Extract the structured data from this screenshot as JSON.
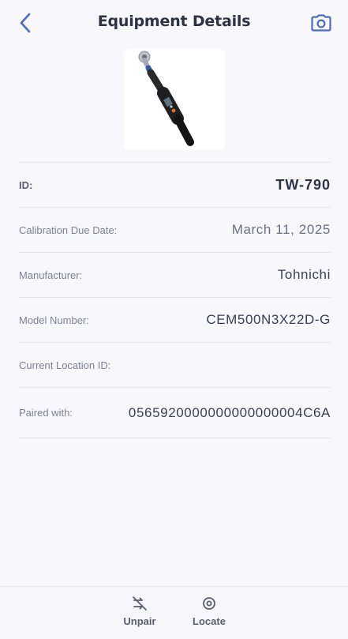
{
  "header": {
    "title": "Equipment Details"
  },
  "equipment_image": {
    "subject": "digital torque wrench"
  },
  "details": [
    {
      "key": "id",
      "label": "ID:",
      "value": "TW-790"
    },
    {
      "key": "calibration",
      "label": "Calibration Due Date:",
      "value": "March 11, 2025"
    },
    {
      "key": "manufacturer",
      "label": "Manufacturer:",
      "value": "Tohnichi"
    },
    {
      "key": "model",
      "label": "Model Number:",
      "value": "CEM500N3X22D-G"
    },
    {
      "key": "location",
      "label": "Current Location ID:",
      "value": ""
    },
    {
      "key": "paired",
      "label": "Paired with:",
      "value": "0565920000000000000004C6A"
    }
  ],
  "bottom_bar": {
    "unpair_label": "Unpair",
    "locate_label": "Locate"
  },
  "colors": {
    "accent": "#4a6cc4",
    "background": "#f8f7fc",
    "divider": "#e6e5ec"
  },
  "icons": {
    "back": "chevron-left-icon",
    "camera": "camera-icon",
    "unpair": "unlink-icon",
    "locate": "target-icon"
  }
}
